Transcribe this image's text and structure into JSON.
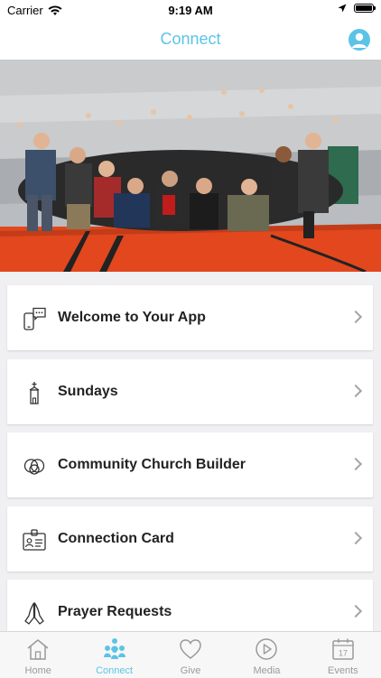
{
  "status_bar": {
    "carrier": "Carrier",
    "time": "9:19 AM"
  },
  "header": {
    "title": "Connect"
  },
  "hero": {
    "description_icon": "group-photo"
  },
  "menu": [
    {
      "label": "Welcome to Your App",
      "icon": "phone-chat-icon"
    },
    {
      "label": "Sundays",
      "icon": "church-icon"
    },
    {
      "label": "Community Church Builder",
      "icon": "overlapping-circles-icon"
    },
    {
      "label": "Connection Card",
      "icon": "id-card-icon"
    },
    {
      "label": "Prayer Requests",
      "icon": "praying-hands-icon"
    }
  ],
  "tabs": [
    {
      "label": "Home",
      "icon": "home-icon"
    },
    {
      "label": "Connect",
      "icon": "people-icon",
      "active": true
    },
    {
      "label": "Give",
      "icon": "heart-icon"
    },
    {
      "label": "Media",
      "icon": "play-icon"
    },
    {
      "label": "Events",
      "icon": "calendar-icon",
      "badge": "17"
    }
  ],
  "colors": {
    "accent": "#5bc4e6",
    "floor": "#e2471e"
  }
}
